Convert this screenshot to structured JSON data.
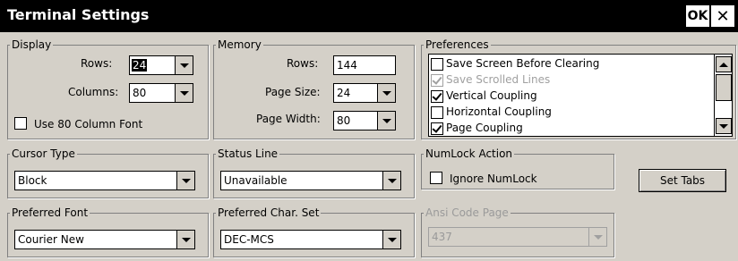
{
  "window": {
    "title": "Terminal Settings",
    "ok_label": "OK",
    "close_label": "✕"
  },
  "display": {
    "legend": "Display",
    "rows_label": "Rows:",
    "rows_value": "24",
    "columns_label": "Columns:",
    "columns_value": "80",
    "use80_label": "Use 80 Column Font",
    "use80_checked": false
  },
  "memory": {
    "legend": "Memory",
    "rows_label": "Rows:",
    "rows_value": "144",
    "page_size_label": "Page Size:",
    "page_size_value": "24",
    "page_width_label": "Page Width:",
    "page_width_value": "80"
  },
  "preferences": {
    "legend": "Preferences",
    "items": [
      {
        "label": "Save Screen Before Clearing",
        "checked": false,
        "enabled": true
      },
      {
        "label": "Save Scrolled Lines",
        "checked": true,
        "enabled": false
      },
      {
        "label": "Vertical Coupling",
        "checked": true,
        "enabled": true
      },
      {
        "label": "Horizontal Coupling",
        "checked": false,
        "enabled": true
      },
      {
        "label": "Page Coupling",
        "checked": true,
        "enabled": true
      }
    ]
  },
  "cursor_type": {
    "legend": "Cursor Type",
    "value": "Block"
  },
  "status_line": {
    "legend": "Status Line",
    "value": "Unavailable"
  },
  "numlock": {
    "legend": "NumLock Action",
    "ignore_label": "Ignore NumLock",
    "checked": false
  },
  "set_tabs_label": "Set Tabs",
  "preferred_font": {
    "legend": "Preferred Font",
    "value": "Courier New"
  },
  "preferred_charset": {
    "legend": "Preferred Char. Set",
    "value": "DEC-MCS"
  },
  "ansi_code_page": {
    "legend": "Ansi Code Page",
    "value": "437",
    "enabled": false
  },
  "icons": {
    "dropdown": "chevron-down-icon",
    "scroll_up": "arrow-up-icon",
    "scroll_down": "arrow-down-icon",
    "checkbox": "checkbox-icon"
  }
}
